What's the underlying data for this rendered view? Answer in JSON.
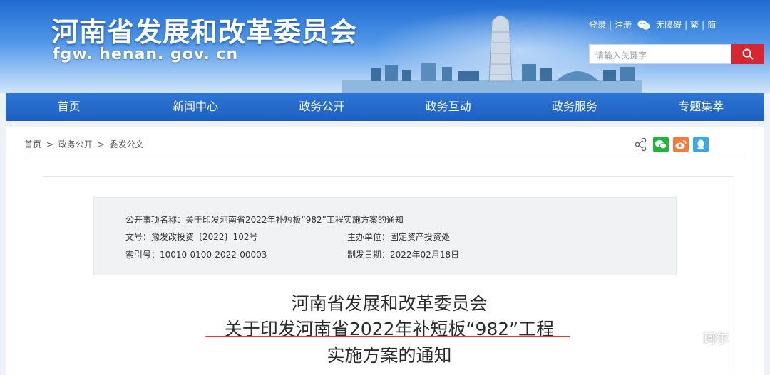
{
  "header": {
    "site_title": "河南省发展和改革委员会",
    "site_domain": "fgw. henan. gov. cn",
    "toplinks": {
      "login": "登录",
      "register": "注册",
      "accessibility": "无障碍",
      "traditional": "繁",
      "simplified": "简",
      "separator": "|"
    },
    "search": {
      "placeholder": "请输入关键字"
    }
  },
  "nav": {
    "items": [
      {
        "label": "首页"
      },
      {
        "label": "新闻中心"
      },
      {
        "label": "政务公开"
      },
      {
        "label": "政务互动"
      },
      {
        "label": "政务服务"
      },
      {
        "label": "专题集萃"
      }
    ]
  },
  "breadcrumb": {
    "items": [
      "首页",
      "政务公开",
      "委发公文"
    ],
    "separator": ">"
  },
  "meta": {
    "item_name_label": "公开事项名称：",
    "item_name_value": "关于印发河南省2022年补短板“982”工程实施方案的通知",
    "doc_no_label": "文号：",
    "doc_no_value": "豫发改投资〔2022〕102号",
    "host_unit_label": "主办单位：",
    "host_unit_value": "固定资产投资处",
    "index_no_label": "索引号：",
    "index_no_value": "10010-0100-2022-00003",
    "issue_date_label": "制发日期：",
    "issue_date_value": "2022年02月18日"
  },
  "document": {
    "title_line1": "河南省发展和改革委员会",
    "title_line2": "关于印发河南省2022年补短板“982”工程",
    "title_line3": "实施方案的通知"
  },
  "watermark": {
    "text": "珂尔"
  },
  "colors": {
    "nav_blue": "#1c5fc2",
    "search_red": "#d7262f",
    "underline_red": "#e0393e",
    "wechat_green": "#21b33b",
    "weibo_orange": "#f27a3b",
    "qq_blue": "#3aa7e6"
  },
  "icons": [
    "wechat-icon",
    "search-icon",
    "share-icon",
    "wechat-share-icon",
    "weibo-share-icon",
    "qq-share-icon",
    "wechat-watermark-icon"
  ]
}
